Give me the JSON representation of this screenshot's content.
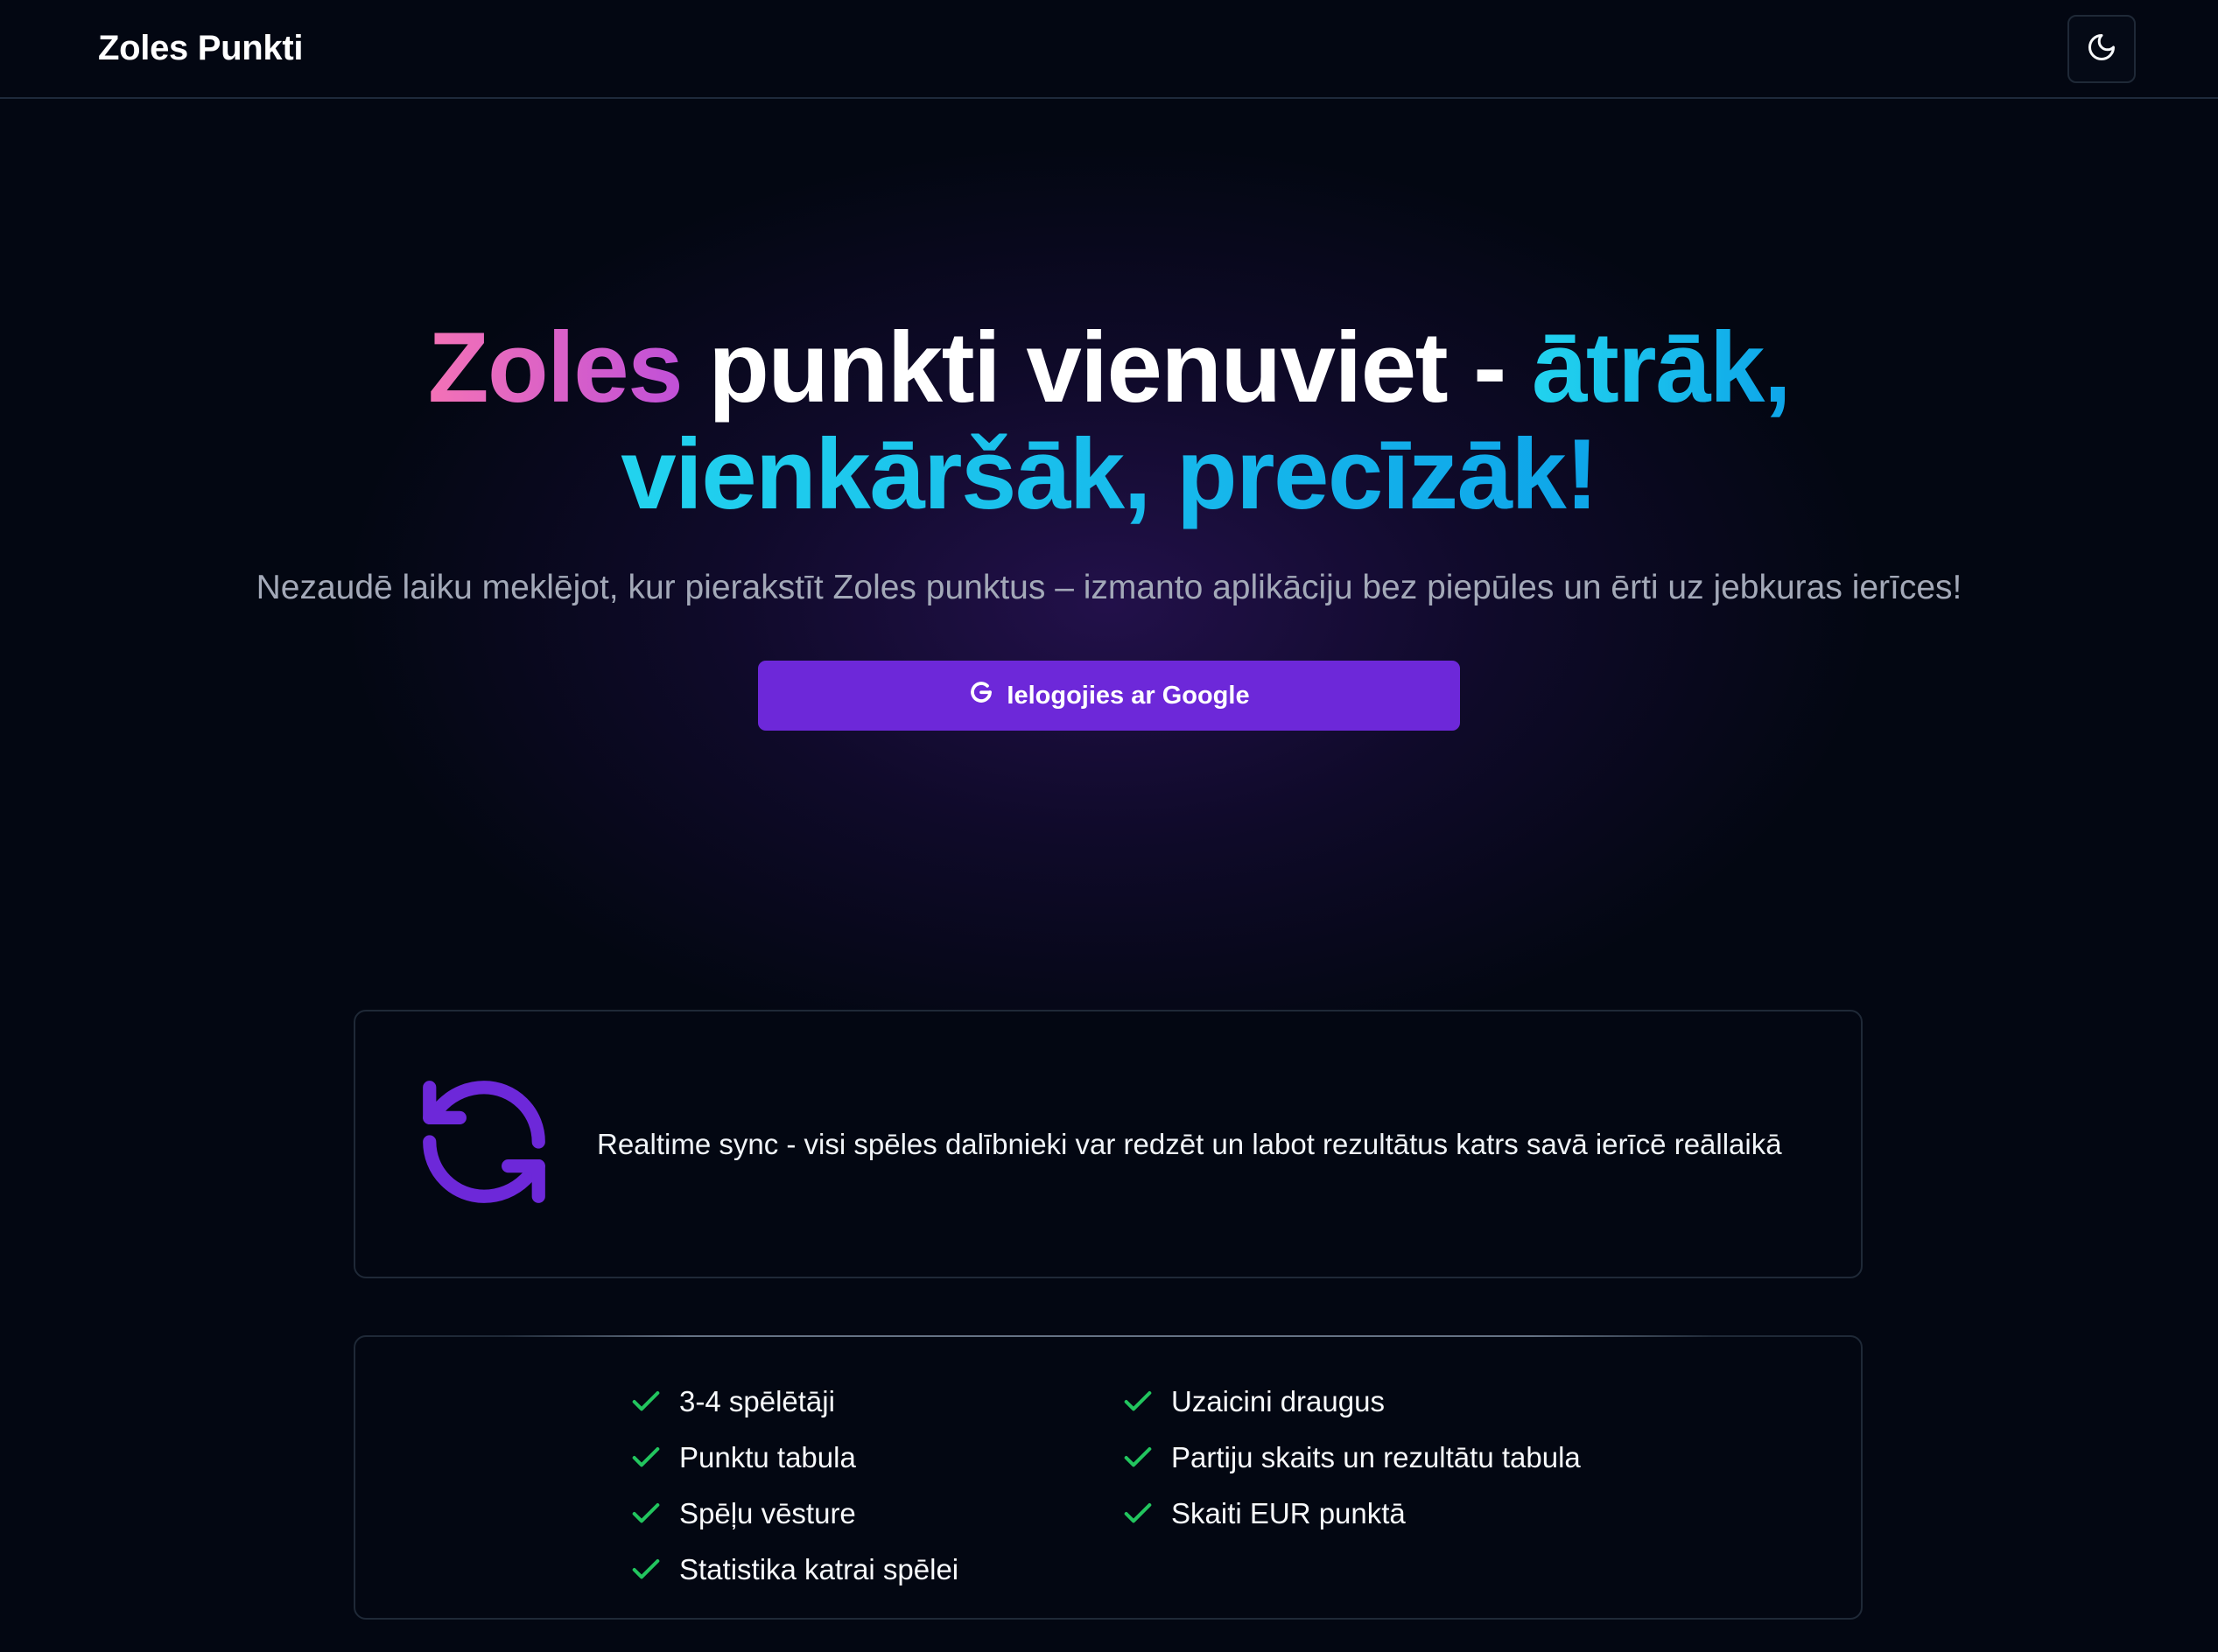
{
  "header": {
    "brand": "Zoles Punkti",
    "theme_toggle_icon": "moon-icon"
  },
  "hero": {
    "title_part1": "Zoles",
    "title_part2": "punkti vienuviet -",
    "title_part3": "ātrāk,",
    "title_part4": "vienkāršāk, precīzāk!",
    "subtitle": "Nezaudē laiku meklējot, kur pierakstīt Zoles punktus – izmanto aplikāciju bez piepūles un ērti uz jebkuras ierīces!",
    "cta_label": "Ielogojies ar Google",
    "cta_icon": "google-icon"
  },
  "sync_card": {
    "icon": "sync-icon",
    "text": "Realtime sync - visi spēles dalībnieki var redzēt un labot rezultātus katrs savā ierīcē reāllaikā"
  },
  "features": {
    "left": [
      "3-4 spēlētāji",
      "Punktu tabula",
      "Spēļu vēsture",
      "Statistika katrai spēlei"
    ],
    "right": [
      "Uzaicini draugus",
      "Partiju skaits un rezultātu tabula",
      "Skaiti EUR punktā"
    ]
  },
  "colors": {
    "background": "#030712",
    "accent_purple": "#6d28d9",
    "check_green": "#22c55e",
    "gradient_pink": "#f472b6",
    "gradient_blue": "#22d3ee"
  }
}
